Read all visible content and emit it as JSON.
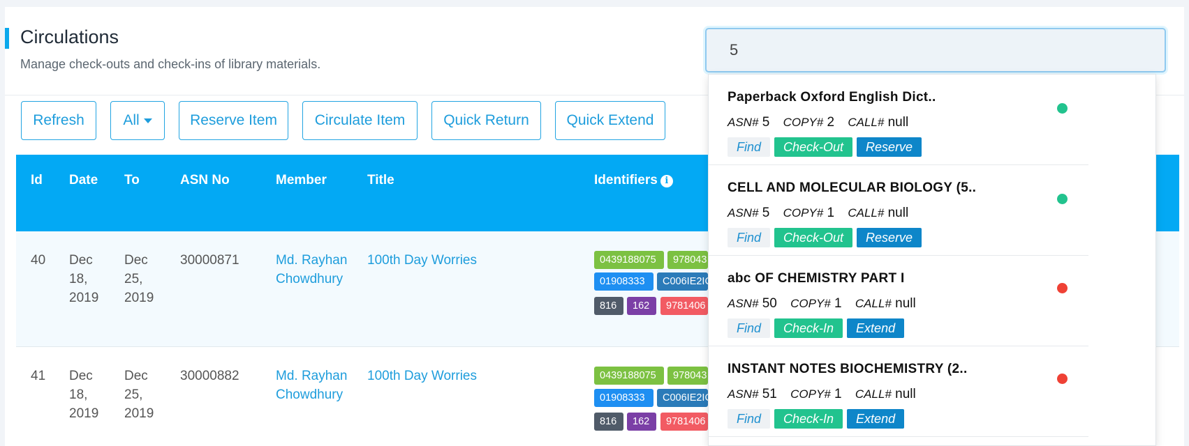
{
  "header": {
    "title": "Circulations",
    "subtitle": "Manage check-outs and check-ins of library materials."
  },
  "toolbar": {
    "refresh": "Refresh",
    "filter": "All",
    "reserve_item": "Reserve Item",
    "circulate_item": "Circulate Item",
    "quick_return": "Quick Return",
    "quick_extend": "Quick Extend"
  },
  "table": {
    "columns": [
      "Id",
      "Date",
      "To",
      "ASN No",
      "Member",
      "Title",
      "Identifiers"
    ],
    "rows": [
      {
        "id": "40",
        "date": [
          "Dec",
          "18,",
          "2019"
        ],
        "to": [
          "Dec",
          "25,",
          "2019"
        ],
        "asn": "30000871",
        "member": [
          "Md. Rayhan",
          "Chowdhury"
        ],
        "title": "100th Day Worries",
        "identifiers": [
          "0439188075",
          "978043",
          "01908333",
          "C006IE2IC",
          "816",
          "162",
          "9781406"
        ]
      },
      {
        "id": "41",
        "date": [
          "Dec",
          "18,",
          "2019"
        ],
        "to": [
          "Dec",
          "25,",
          "2019"
        ],
        "asn": "30000882",
        "member": [
          "Md. Rayhan",
          "Chowdhury"
        ],
        "title": "100th Day Worries",
        "identifiers": [
          "0439188075",
          "978043",
          "01908333",
          "C006IE2IC",
          "816",
          "162",
          "9781406"
        ]
      }
    ]
  },
  "search": {
    "value": "5"
  },
  "dropdown": {
    "meta_labels": {
      "asn": "ASN#",
      "copy": "COPY#",
      "call": "CALL#"
    },
    "items": [
      {
        "title": "Paperback Oxford English Dict..",
        "asn": "5",
        "copy": "2",
        "call": "null",
        "actions": [
          "Find",
          "Check-Out",
          "Reserve"
        ],
        "status": "available",
        "status_color": "#22c38e"
      },
      {
        "title": "CELL AND MOLECULAR BIOLOGY (5..",
        "asn": "5",
        "copy": "1",
        "call": "null",
        "actions": [
          "Find",
          "Check-Out",
          "Reserve"
        ],
        "status": "available",
        "status_color": "#22c38e"
      },
      {
        "title": "abc OF CHEMISTRY PART I",
        "asn": "50",
        "copy": "1",
        "call": "null",
        "actions": [
          "Find",
          "Check-In",
          "Extend"
        ],
        "status": "checked-out",
        "status_color": "#ef4135"
      },
      {
        "title": "INSTANT NOTES BIOCHEMISTRY (2..",
        "asn": "51",
        "copy": "1",
        "call": "null",
        "actions": [
          "Find",
          "Check-In",
          "Extend"
        ],
        "status": "checked-out",
        "status_color": "#ef4135"
      }
    ]
  },
  "colors": {
    "accent": "#03a9f4",
    "link": "#1e9ddc",
    "green": "#22c38e",
    "blue": "#0e86c9",
    "red": "#ef4135"
  }
}
